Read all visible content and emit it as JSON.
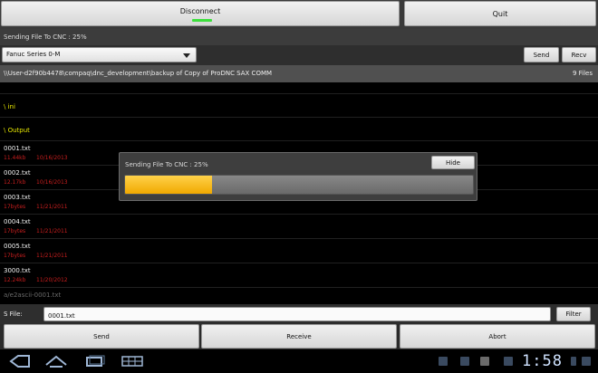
{
  "header": {
    "disconnect_label": "Disconnect",
    "quit_label": "Quit"
  },
  "status": {
    "text": "Sending File To CNC : 25%"
  },
  "controls": {
    "machine_select": "Fanuc Series 0-M",
    "send_label": "Send",
    "recv_label": "Recv"
  },
  "path": {
    "value": "\\\\User-d2f90b4478\\compaq\\dnc_development\\backup of Copy of ProDNC SAX COMM",
    "count": "9 Files"
  },
  "dirs": [
    {
      "name": "\\ ini"
    },
    {
      "name": "\\ Output"
    }
  ],
  "files": [
    {
      "name": "0001.txt",
      "size": "11.44kb",
      "date": "10/16/2013"
    },
    {
      "name": "0002.txt",
      "size": "12.17kb",
      "date": "10/16/2013"
    },
    {
      "name": "0003.txt",
      "size": "17bytes",
      "date": "11/21/2011"
    },
    {
      "name": "0004.txt",
      "size": "17bytes",
      "date": "11/21/2011"
    },
    {
      "name": "0005.txt",
      "size": "17bytes",
      "date": "11/21/2011"
    },
    {
      "name": "3000.txt",
      "size": "12.24kb",
      "date": "11/20/2012"
    },
    {
      "name": "a/e2ascii-0001.txt"
    }
  ],
  "dialog": {
    "title": "Sending File To CNC : 25%",
    "hide_label": "Hide",
    "progress": 0.25
  },
  "filebar": {
    "label": "S File:",
    "value": "0001.txt",
    "filter_label": "Filter"
  },
  "bottom": {
    "send_label": "Send",
    "receive_label": "Receive",
    "abort_label": "Abort"
  },
  "system": {
    "clock": "1:58"
  },
  "colors": {
    "accent_progress": "#f0a800",
    "dir_text": "#e8e800",
    "meta_text": "#c81e1e",
    "indicator": "#3ce03c"
  }
}
